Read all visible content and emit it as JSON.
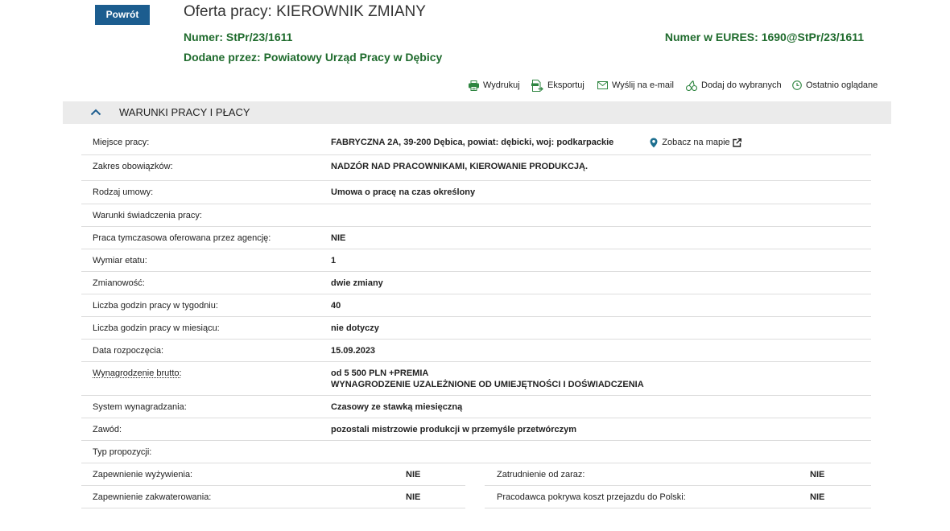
{
  "back_button": {
    "label": "Powrót"
  },
  "offer": {
    "title": "Oferta pracy: KIEROWNIK ZMIANY",
    "number_label": "Numer:",
    "number_value": "StPr/23/1611",
    "eures_label": "Numer w EURES:",
    "eures_value": "1690@StPr/23/1611",
    "added_by_label": "Dodane przez:",
    "added_by_value": "Powiatowy Urząd Pracy w Dębicy"
  },
  "toolbar": [
    {
      "label": "Wydrukuj",
      "icon": "printer-icon"
    },
    {
      "label": "Eksportuj",
      "icon": "export-icon"
    },
    {
      "label": "Wyślij na e-mail",
      "icon": "envelope-icon"
    },
    {
      "label": "Dodaj do wybranych",
      "icon": "cherries-icon"
    },
    {
      "label": "Ostatnio oglądane",
      "icon": "clock-icon"
    }
  ],
  "section": {
    "title": "WARUNKI PRACY I PŁACY",
    "icon": "chevron-up-icon",
    "expanded": true
  },
  "conditions": {
    "rows": [
      {
        "label": "Miejsce pracy:",
        "value": "FABRYCZNA 2A, 39-200 Dębica, powiat: dębicki, woj: podkarpackie",
        "link": "Zobacz na mapie",
        "link_icon": "map-pin-icon",
        "link_external_icon": "external-link-icon"
      },
      {
        "label": "Zakres obowiązków:",
        "value": "NADZÓR NAD PRACOWNIKAMI, KIEROWANIE PRODUKCJĄ."
      },
      {
        "label": "Rodzaj umowy:",
        "value": "Umowa o pracę na czas określony"
      },
      {
        "label": "Warunki świadczenia pracy:",
        "value": ""
      },
      {
        "label": "Praca tymczasowa oferowana przez agencję:",
        "value": "NIE"
      },
      {
        "label": "Wymiar etatu:",
        "value": "1"
      },
      {
        "label": "Zmianowość:",
        "value": "dwie zmiany"
      },
      {
        "label": "Liczba godzin pracy w tygodniu:",
        "value": "40"
      },
      {
        "label": "Liczba godzin pracy w miesiącu:",
        "value": "nie dotyczy"
      },
      {
        "label": "Data rozpoczęcia:",
        "value": "15.09.2023"
      },
      {
        "label": "Wynagrodzenie brutto:",
        "value_lines": [
          "od 5 500 PLN +PREMIA",
          "WYNAGRODZENIE UZALEŻNIONE OD UMIEJĘTNOŚCI I DOŚWIADCZENIA"
        ]
      },
      {
        "label": "System wynagradzania:",
        "value": "Czasowy ze stawką miesięczną"
      },
      {
        "label": "Zawód:",
        "value": "pozostali mistrzowie produkcji w przemyśle przetwórczym"
      },
      {
        "label": "Typ propozycji:",
        "value": ""
      }
    ],
    "pairs": [
      [
        {
          "label": "Zapewnienie wyżywienia:",
          "value": "NIE"
        },
        {
          "label": "Zatrudnienie od zaraz:",
          "value": "NIE"
        }
      ],
      [
        {
          "label": "Zapewnienie zakwaterowania:",
          "value": "NIE"
        },
        {
          "label": "Pracodawca pokrywa koszt przejazdu do Polski:",
          "value": "NIE"
        }
      ]
    ]
  },
  "colors": {
    "brand": "#1c5d8f",
    "green": "#1f6b2d",
    "icon_green": "#2e8540",
    "pin": "#1d6f8f",
    "text": "#222222",
    "section_bg": "#ebebeb",
    "divider": "#dddddd"
  }
}
